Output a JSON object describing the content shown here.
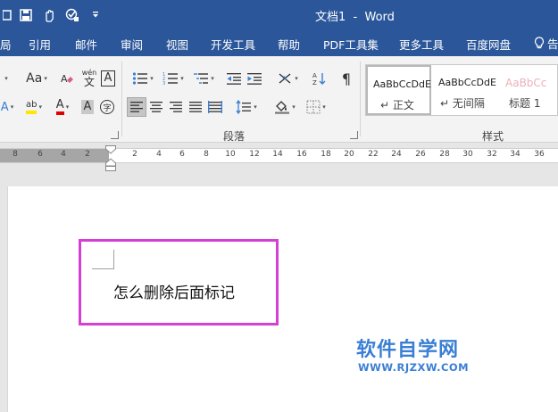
{
  "title": "文档1  -  Word",
  "menu": {
    "items": [
      "局",
      "引用",
      "邮件",
      "审阅",
      "视图",
      "开发工具",
      "帮助",
      "PDF工具集",
      "更多工具",
      "百度网盘"
    ],
    "last_label": "告"
  },
  "ribbon": {
    "font_size_label": "Aa",
    "phonetic_label": "wén",
    "border_char_label": "A",
    "shading_char_label": "A",
    "enclose_char_label": "字",
    "groups": {
      "paragraph": "段落",
      "styles": "样式"
    },
    "styles": [
      {
        "sample": "AaBbCcDdE",
        "name": "↵ 正文"
      },
      {
        "sample": "AaBbCcDdE",
        "name": "↵ 无间隔"
      },
      {
        "sample": "AaBbCc",
        "name": "标题 1"
      }
    ]
  },
  "ruler": {
    "left_ticks": [
      "8",
      "6",
      "4",
      "2"
    ],
    "right_ticks": [
      "2",
      "4",
      "6",
      "8",
      "10",
      "12",
      "14",
      "16",
      "18",
      "20",
      "22",
      "24",
      "26",
      "28",
      "30",
      "32",
      "34",
      "36"
    ]
  },
  "document": {
    "text": "怎么删除后面标记"
  },
  "watermark": {
    "cn": "软件自学网",
    "en": "WWW.RJZXW.COM"
  },
  "colors": {
    "brand": "#2b579a",
    "highlight_box": "#d53fd5",
    "watermark": "#3a7fd5",
    "highlight_pen": "#ffe600",
    "font_color": "#e00000"
  }
}
